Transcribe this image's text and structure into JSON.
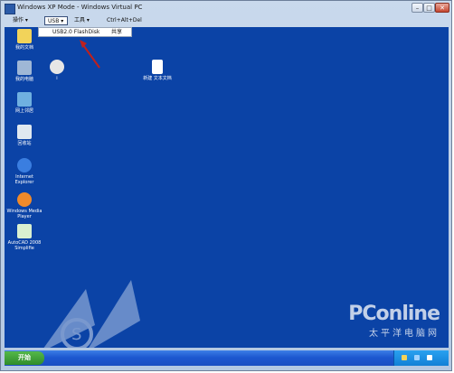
{
  "window": {
    "title": "Windows XP Mode - Windows Virtual PC",
    "min": "–",
    "max": "□",
    "close": "✕"
  },
  "menubar": {
    "items": [
      "操作",
      "USB",
      "工具",
      "Ctrl+Alt+Del"
    ]
  },
  "usb_menu": {
    "items": [
      "USB2.0 FlashDisk",
      "共享"
    ]
  },
  "desktop": {
    "icons": [
      {
        "id": "my-documents",
        "label": "我的文档",
        "color": "#f2d35a"
      },
      {
        "id": "my-computer",
        "label": "我的电脑",
        "color": "#9fb7d6"
      },
      {
        "id": "network",
        "label": "网上邻居",
        "color": "#6fb0e0"
      },
      {
        "id": "recycle-bin",
        "label": "回收站",
        "color": "#dfe8f0"
      },
      {
        "id": "ie",
        "label": "Internet Explorer",
        "color": "#3a7ee0"
      },
      {
        "id": "wmp",
        "label": "Windows Media Player",
        "color": "#f08a2a"
      },
      {
        "id": "autocad",
        "label": "AutoCAD 2008 Simplifie",
        "color": "#d9f0d0"
      },
      {
        "id": "disc",
        "label": "i",
        "color": "#e6e6e6"
      },
      {
        "id": "new-text",
        "label": "新建 文本文档",
        "color": "#ffffff"
      }
    ]
  },
  "taskbar": {
    "start_label": "开始"
  },
  "brand": {
    "line1": "PConline",
    "line2": "太平洋电脑网"
  }
}
